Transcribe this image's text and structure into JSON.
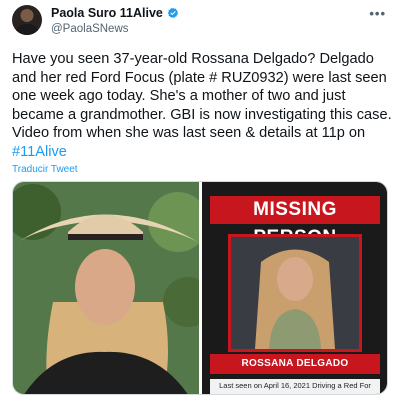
{
  "author": {
    "display_name": "Paola Suro 11Alive",
    "handle": "@PaolaSNews",
    "verified": true
  },
  "menu": {
    "more_icon": "more-horizontal-icon",
    "more_label": "•••"
  },
  "tweet": {
    "text_before_hashtag": "Have you seen 37-year-old Rossana Delgado? Delgado and her red Ford Focus (plate # RUZ0932) were last seen one week ago today. She's a mother of two and just became a grandmother. GBI is now investigating this case. Video from when she was last seen & details at 11p on ",
    "hashtag": "#11Alive",
    "translate_label": "Traducir Tweet"
  },
  "media": {
    "poster": {
      "title": "MISSING PERSON",
      "name": "ROSSANA DELGADO",
      "caption": "Last seen on April 16, 2021  Driving a Red For"
    }
  },
  "colors": {
    "link": "#1d9bf0",
    "poster_red": "#c8161e",
    "verified": "#1d9bf0"
  }
}
